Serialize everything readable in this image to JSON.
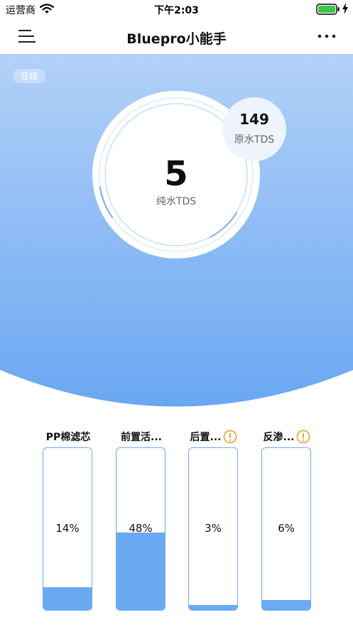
{
  "status_bar": {
    "carrier": "运营商",
    "time": "下午2:03"
  },
  "nav": {
    "title": "Bluepro小能手",
    "menu_icon": "hamburger-menu-icon",
    "more_icon": "more-dots-icon"
  },
  "device": {
    "status": "在线",
    "pure_tds_value": "5",
    "pure_tds_label": "纯水TDS",
    "raw_tds_value": "149",
    "raw_tds_label": "原水TDS"
  },
  "filters": [
    {
      "name": "PP棉滤芯",
      "percent_text": "14%",
      "percent": 14,
      "warning": false
    },
    {
      "name": "前置活...",
      "percent_text": "48%",
      "percent": 48,
      "warning": false
    },
    {
      "name": "后置...",
      "percent_text": "3%",
      "percent": 3,
      "warning": true
    },
    {
      "name": "反渗...",
      "percent_text": "6%",
      "percent": 6,
      "warning": true
    }
  ],
  "colors": {
    "accent": "#6aaaf0",
    "hero_top": "#b3d1f8",
    "hero_bottom": "#6aa7f2",
    "warning": "#f0a020"
  }
}
